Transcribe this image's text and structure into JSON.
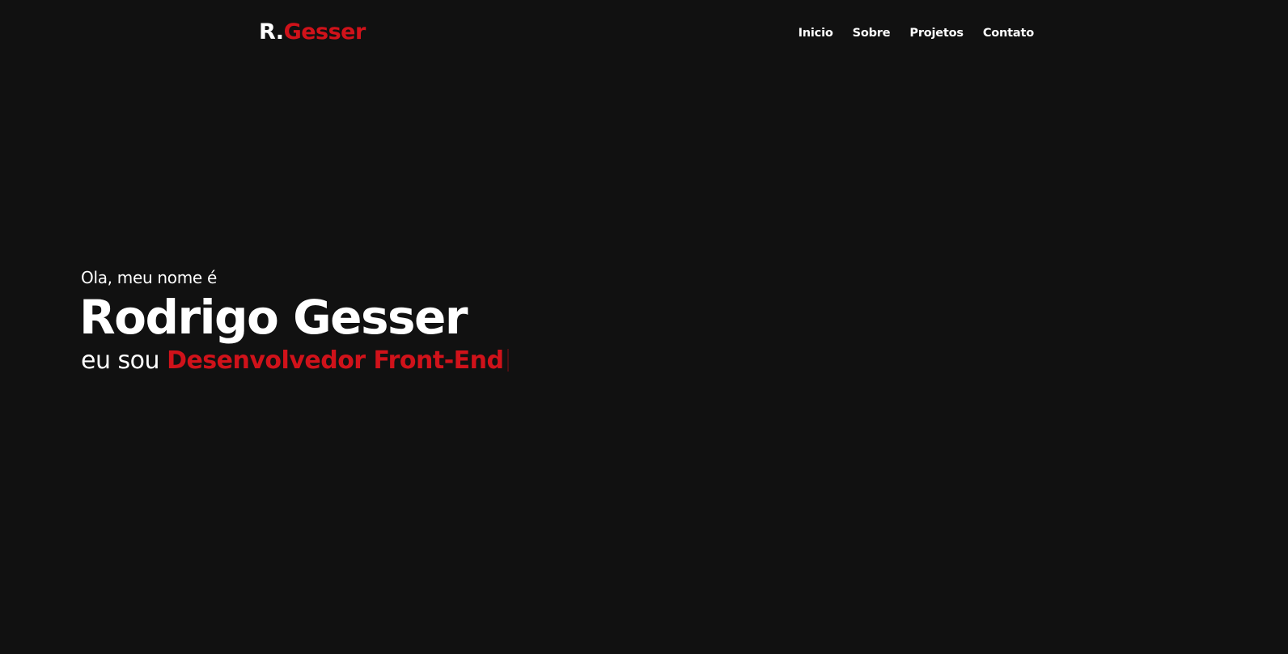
{
  "brand": {
    "prefix": "R.",
    "accent": "Gesser"
  },
  "nav": {
    "items": [
      {
        "label": "Inicio"
      },
      {
        "label": "Sobre"
      },
      {
        "label": "Projetos"
      },
      {
        "label": "Contato"
      }
    ]
  },
  "hero": {
    "greeting": "Ola, meu nome é",
    "name": "Rodrigo Gesser",
    "role_prefix": "eu sou",
    "role_highlight": "Desenvolvedor Front-End"
  },
  "colors": {
    "background": "#111111",
    "text": "#ffffff",
    "accent": "#d0121a"
  }
}
